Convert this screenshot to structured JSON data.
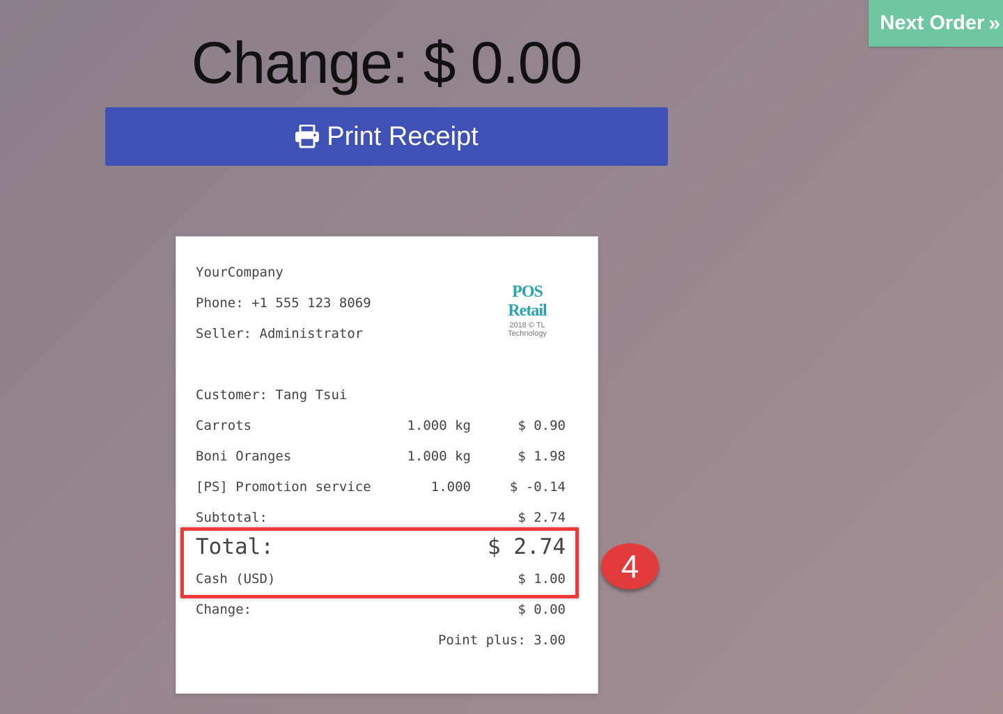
{
  "header": {
    "next_order_label": "Next Order",
    "next_order_chevron": "»",
    "change_title": "Change: $ 0.00",
    "print_receipt_label": "Print Receipt"
  },
  "receipt": {
    "company": "YourCompany",
    "phone": "Phone: +1 555 123 8069",
    "seller": "Seller: Administrator",
    "logo_title": "POS Retail",
    "logo_subtitle": "2018 © TL Technology",
    "customer": "Customer: Tang Tsui",
    "items": [
      {
        "name": "Carrots",
        "qty": "1.000 kg",
        "price": "$ 0.90"
      },
      {
        "name": "Boni Oranges",
        "qty": "1.000 kg",
        "price": "$ 1.98"
      },
      {
        "name": "[PS] Promotion service",
        "qty": "1.000",
        "price": "$ -0.14"
      }
    ],
    "subtotal_label": "Subtotal:",
    "subtotal_value": "$ 2.74",
    "total_label": "Total:",
    "total_value": "$ 2.74",
    "cash_label": "Cash (USD)",
    "cash_value": "$ 1.00",
    "change_label": "Change:",
    "change_value": "$ 0.00",
    "points": "Point plus: 3.00"
  },
  "annotation": {
    "step_number": "4",
    "highlight_color": "#ea3a3a"
  },
  "colors": {
    "print_button": "#3f51b5",
    "next_order_button": "#6ec7a0"
  },
  "icons": {
    "print": "printer-icon",
    "next": "chevron-double-right-icon"
  }
}
